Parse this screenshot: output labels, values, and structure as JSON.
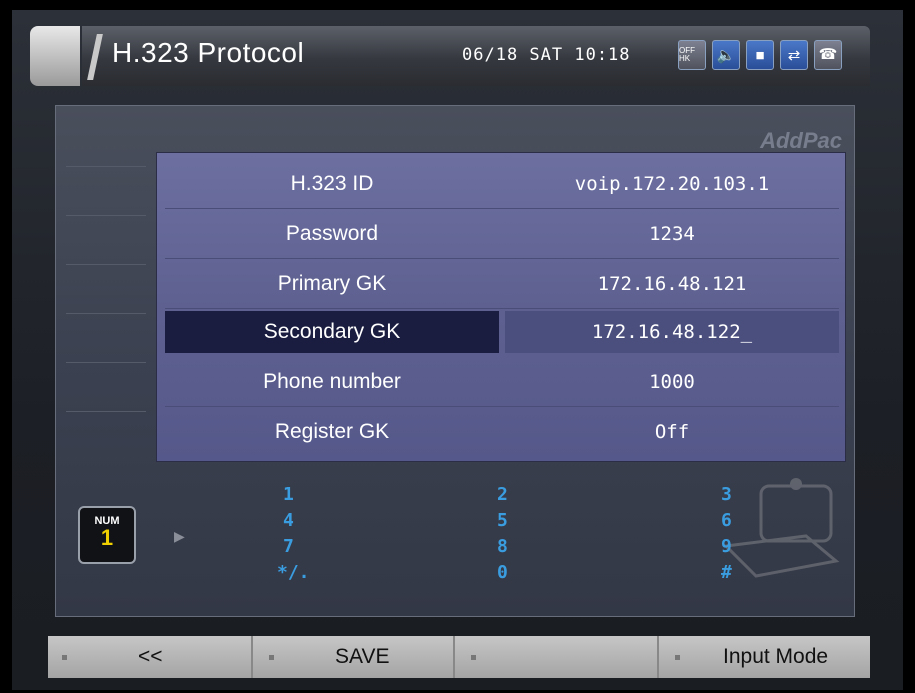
{
  "title": {
    "text": "H.323 Protocol",
    "datetime": "06/18 SAT 10:18",
    "icons": [
      "off-hook-icon",
      "speaker-icon",
      "user-icon",
      "network-icon",
      "handset-icon"
    ],
    "icon_off_label": "OFF HK"
  },
  "brand": "AddPac",
  "settings": [
    {
      "label": "H.323 ID",
      "value": "voip.172.20.103.1"
    },
    {
      "label": "Password",
      "value": "1234"
    },
    {
      "label": "Primary GK",
      "value": "172.16.48.121"
    },
    {
      "label": "Secondary GK",
      "value": "172.16.48.122_"
    },
    {
      "label": "Phone number",
      "value": "1000"
    },
    {
      "label": "Register GK",
      "value": "Off"
    }
  ],
  "selected_row": "Secondary GK",
  "num_badge": {
    "label": "NUM",
    "value": "1"
  },
  "keypad": [
    "1",
    "2",
    "3",
    "4",
    "5",
    "6",
    "7",
    "8",
    "9",
    "*/.",
    "0",
    "#"
  ],
  "bottom_bar": {
    "back": "<<",
    "save": "SAVE",
    "blank": "",
    "input_mode": "Input Mode"
  },
  "colors": {
    "accent_selected": "#1a1d40",
    "keypad": "#3a9de0",
    "panel": "#5e6190"
  }
}
